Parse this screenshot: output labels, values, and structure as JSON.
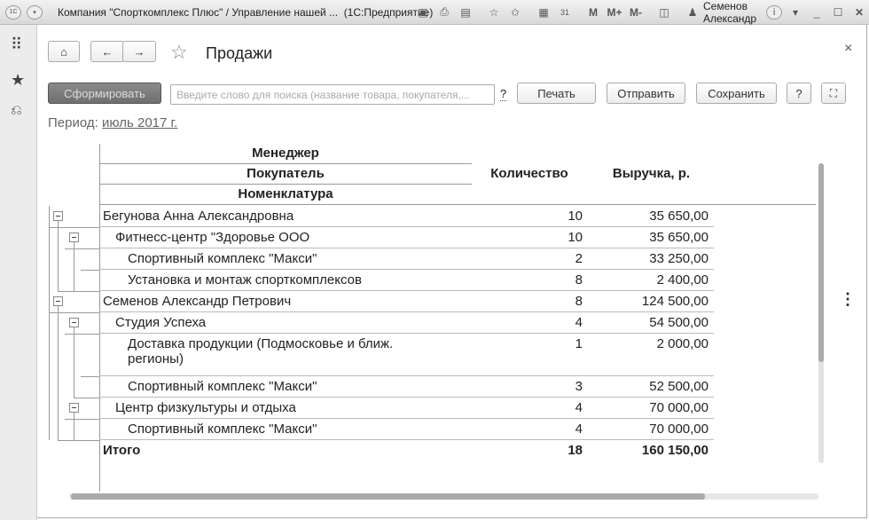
{
  "titlebar": {
    "title": "Компания \"Спорткомплекс Плюс\" / Управление нашей ...  (1С:Предприятие)",
    "m": "M",
    "mplus": "M+",
    "mminus": "M-",
    "user": "Семенов Александр"
  },
  "page": {
    "title": "Продажи",
    "close": "×"
  },
  "toolbar": {
    "generate": "Сформировать",
    "search_placeholder": "Введите слово для поиска (название товара, покупателя,...",
    "help": "?",
    "print": "Печать",
    "send": "Отправить",
    "save": "Сохранить",
    "question": "?"
  },
  "period": {
    "label": "Период:",
    "value": "июль 2017 г."
  },
  "report": {
    "headers": {
      "manager": "Менеджер",
      "buyer": "Покупатель",
      "item": "Номенклатура",
      "qty": "Количество",
      "revenue": "Выручка, р."
    },
    "rows": [
      {
        "level": 0,
        "name": "Бегунова Анна Александровна",
        "qty": "10",
        "sum": "35 650,00"
      },
      {
        "level": 1,
        "name": "Фитнесс-центр \"Здоровье ООО",
        "qty": "10",
        "sum": "35 650,00"
      },
      {
        "level": 2,
        "name": "Спортивный комплекс \"Макси\"",
        "qty": "2",
        "sum": "33 250,00"
      },
      {
        "level": 2,
        "name": "Установка и монтаж спорткомплексов",
        "qty": "8",
        "sum": "2 400,00"
      },
      {
        "level": 0,
        "name": "Семенов Александр Петрович",
        "qty": "8",
        "sum": "124 500,00"
      },
      {
        "level": 1,
        "name": "Студия Успеха",
        "qty": "4",
        "sum": "54 500,00"
      },
      {
        "level": 2,
        "name": "Доставка продукции (Подмосковье и ближ. регионы)",
        "qty": "1",
        "sum": "2 000,00"
      },
      {
        "level": 2,
        "name": "Спортивный комплекс \"Макси\"",
        "qty": "3",
        "sum": "52 500,00"
      },
      {
        "level": 1,
        "name": "Центр физкультуры и отдыха",
        "qty": "4",
        "sum": "70 000,00"
      },
      {
        "level": 2,
        "name": "Спортивный комплекс \"Макси\"",
        "qty": "4",
        "sum": "70 000,00"
      }
    ],
    "total": {
      "label": "Итого",
      "qty": "18",
      "sum": "160 150,00"
    }
  }
}
